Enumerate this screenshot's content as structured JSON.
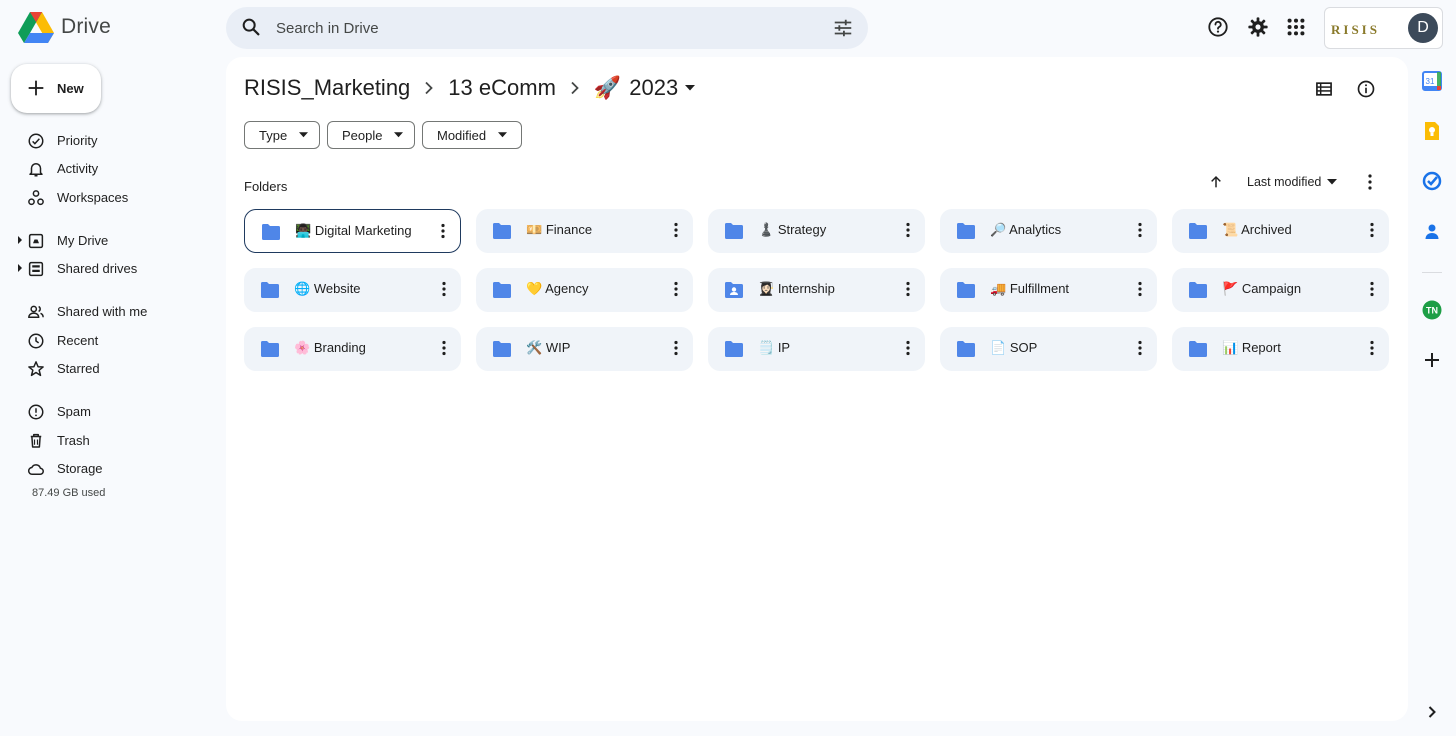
{
  "app": {
    "name": "Drive"
  },
  "search": {
    "placeholder": "Search in Drive"
  },
  "account": {
    "brand": "RISIS",
    "avatar_letter": "D"
  },
  "new_button": {
    "label": "New"
  },
  "sidebar": {
    "items": [
      {
        "label": "Priority",
        "icon": "priority-icon"
      },
      {
        "label": "Activity",
        "icon": "bell-icon"
      },
      {
        "label": "Workspaces",
        "icon": "workspaces-icon"
      },
      {
        "label": "My Drive",
        "icon": "my-drive-icon"
      },
      {
        "label": "Shared drives",
        "icon": "shared-drives-icon"
      },
      {
        "label": "Shared with me",
        "icon": "people-icon"
      },
      {
        "label": "Recent",
        "icon": "clock-icon"
      },
      {
        "label": "Starred",
        "icon": "star-icon"
      },
      {
        "label": "Spam",
        "icon": "spam-icon"
      },
      {
        "label": "Trash",
        "icon": "trash-icon"
      },
      {
        "label": "Storage",
        "icon": "cloud-icon"
      }
    ],
    "storage_used": "87.49 GB used"
  },
  "breadcrumb": {
    "items": [
      "RISIS_Marketing",
      "13 eComm",
      "2023"
    ],
    "current_emoji": "🚀"
  },
  "filters": [
    "Type",
    "People",
    "Modified"
  ],
  "section_label": "Folders",
  "sort": {
    "label": "Last modified"
  },
  "folders": [
    {
      "emoji": "👨🏿‍💻",
      "name": "Digital Marketing",
      "selected": true,
      "shared": false
    },
    {
      "emoji": "💴",
      "name": "Finance",
      "selected": false,
      "shared": false
    },
    {
      "emoji": "♟️",
      "name": "Strategy",
      "selected": false,
      "shared": false
    },
    {
      "emoji": "🔎",
      "name": "Analytics",
      "selected": false,
      "shared": false
    },
    {
      "emoji": "📜",
      "name": "Archived",
      "selected": false,
      "shared": false
    },
    {
      "emoji": "🌐",
      "name": "Website",
      "selected": false,
      "shared": false
    },
    {
      "emoji": "💛",
      "name": "Agency",
      "selected": false,
      "shared": false
    },
    {
      "emoji": "👩🏻‍🎓",
      "name": "Internship",
      "selected": false,
      "shared": true
    },
    {
      "emoji": "🚚",
      "name": "Fulfillment",
      "selected": false,
      "shared": false
    },
    {
      "emoji": "🚩",
      "name": "Campaign",
      "selected": false,
      "shared": false
    },
    {
      "emoji": "🌸",
      "name": "Branding",
      "selected": false,
      "shared": false
    },
    {
      "emoji": "🛠️",
      "name": "WIP",
      "selected": false,
      "shared": false
    },
    {
      "emoji": "🗒️",
      "name": "IP",
      "selected": false,
      "shared": false
    },
    {
      "emoji": "📄",
      "name": "SOP",
      "selected": false,
      "shared": false
    },
    {
      "emoji": "📊",
      "name": "Report",
      "selected": false,
      "shared": false
    }
  ],
  "right_rail": [
    "calendar-icon",
    "keep-icon",
    "tasks-icon",
    "contacts-icon",
    "tn-addon-icon",
    "add-icon",
    "chevron-right-icon"
  ],
  "colors": {
    "folder_blue": "#4f86e8",
    "background": "#f8fafd",
    "selected_border": "#1f3a5f"
  }
}
